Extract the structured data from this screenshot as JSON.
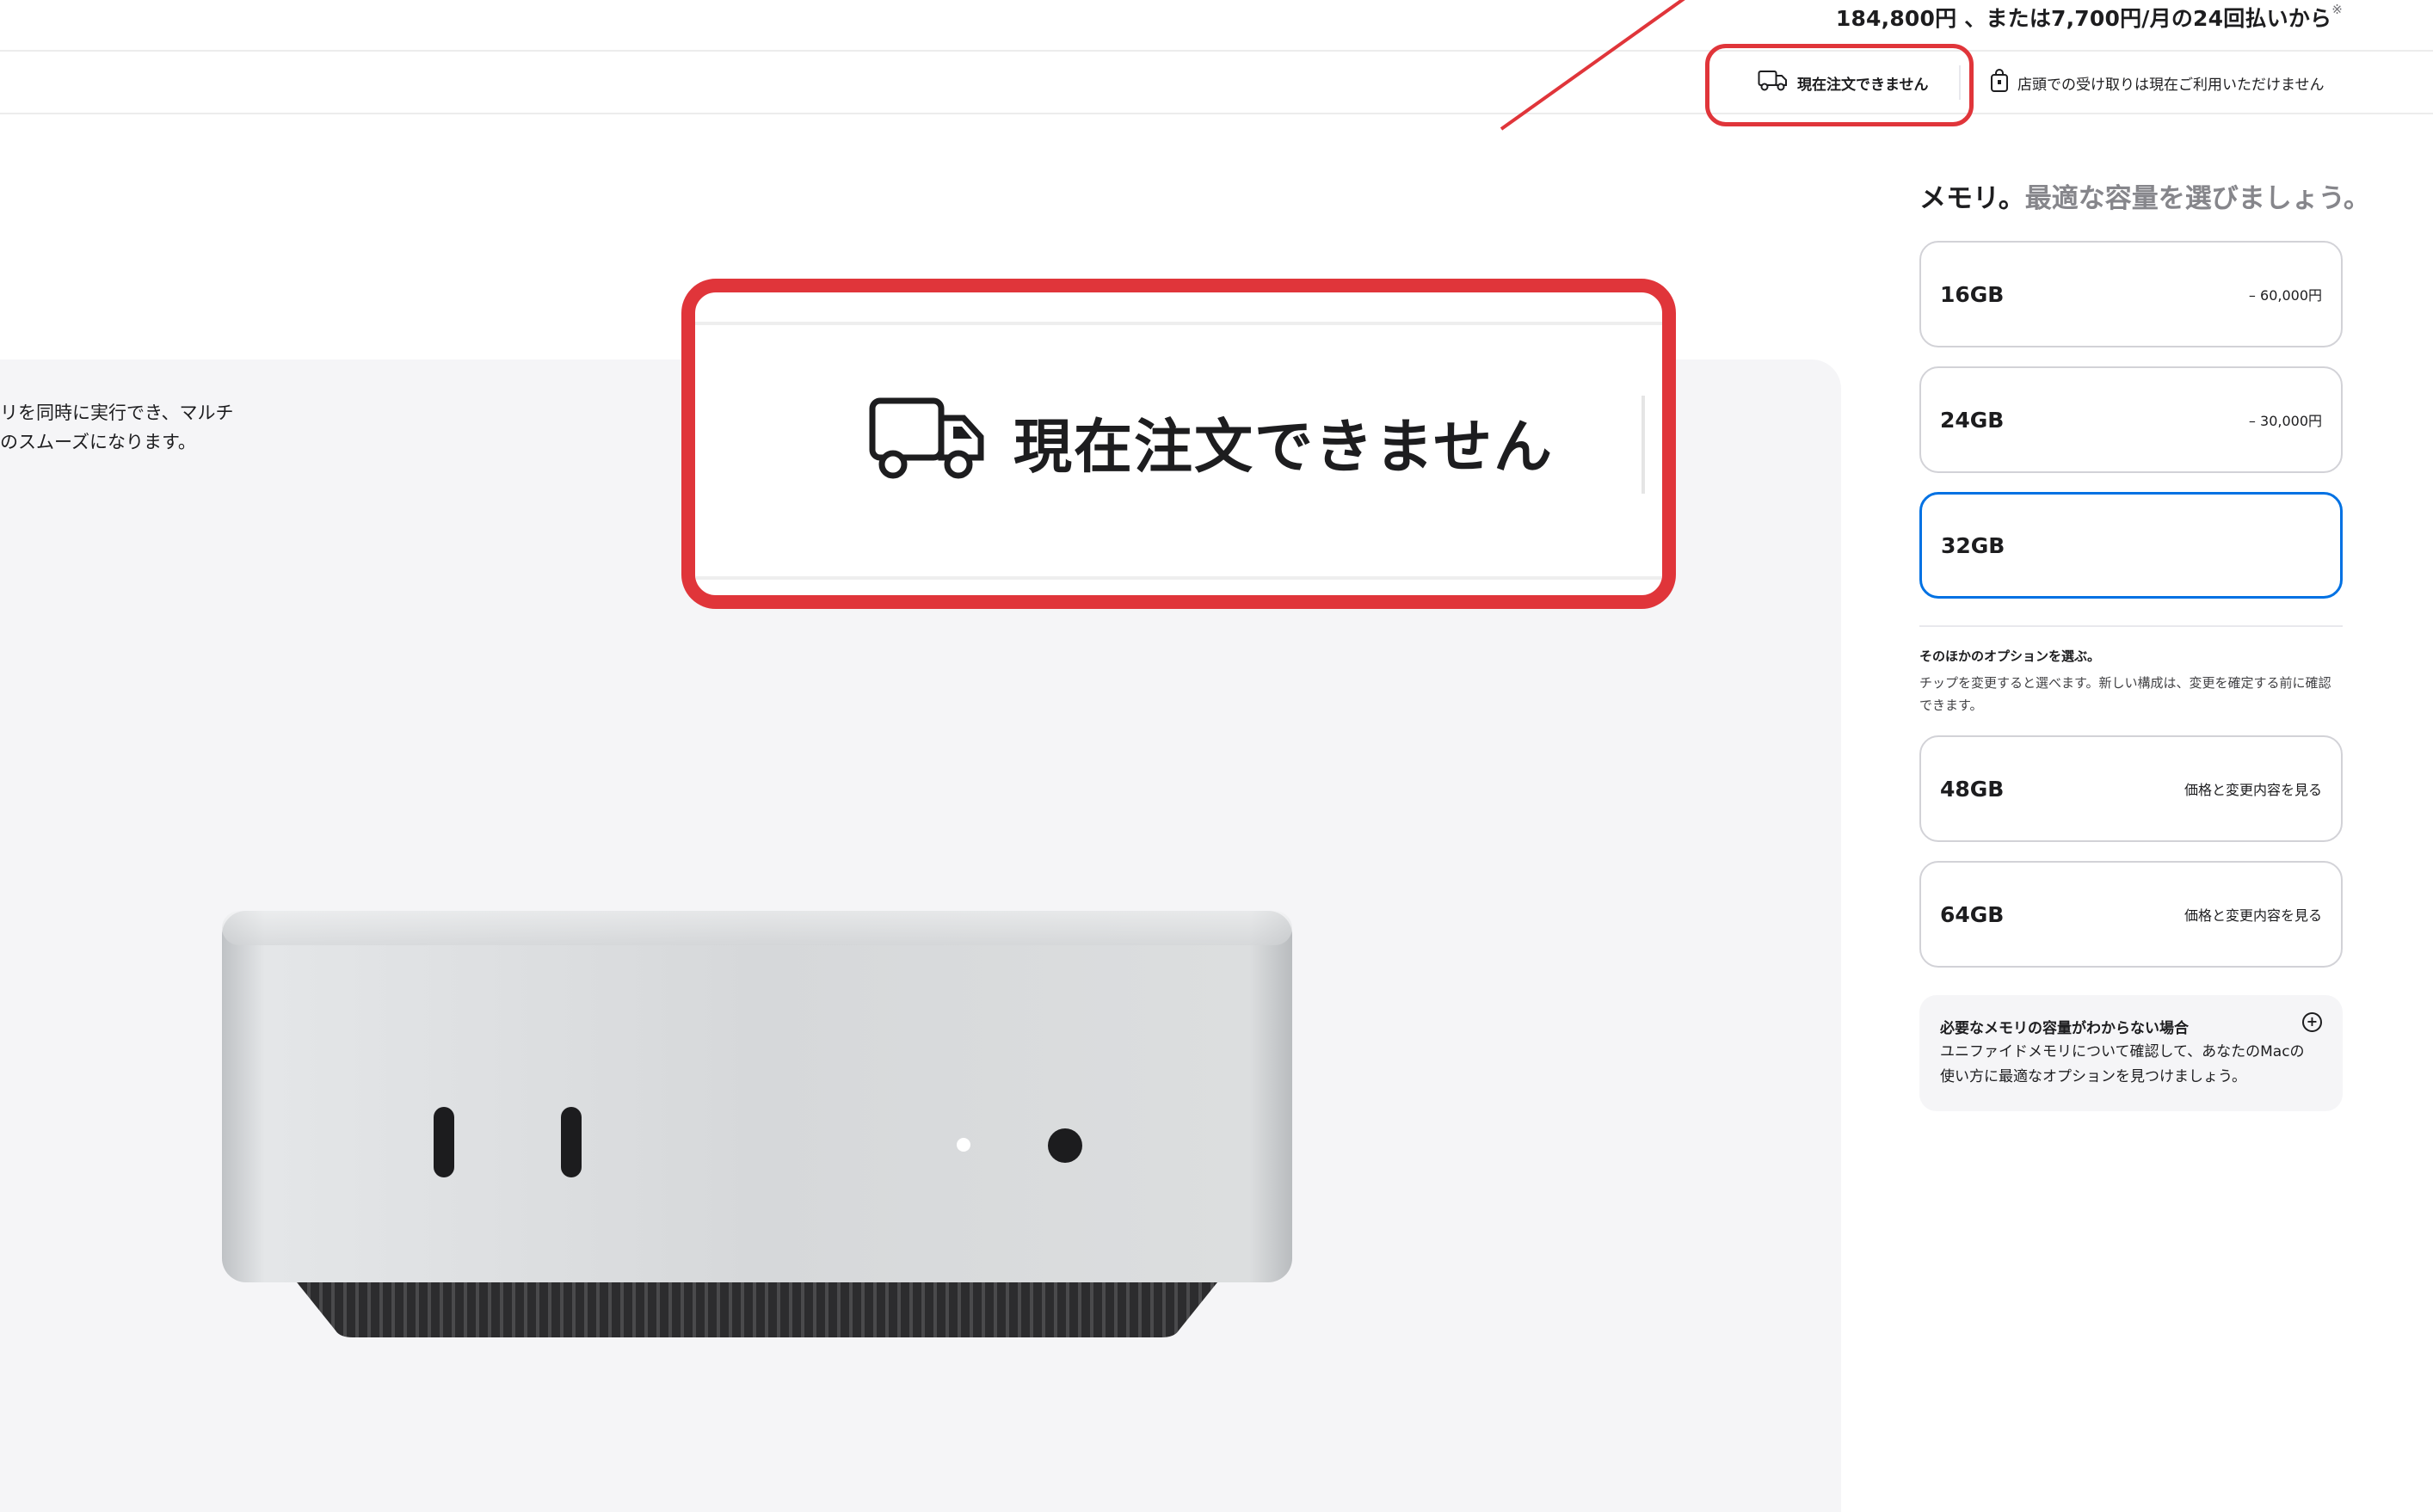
{
  "header": {
    "price_main": "184,800円 、または7,700円/月の24回払いから",
    "price_note": "※"
  },
  "availability": {
    "delivery": "現在注文できません",
    "pickup": "店頭での受け取りは現在ご利用いただけません"
  },
  "callout": {
    "zoom_text": "現在注文できません"
  },
  "gallery": {
    "text_line1": "リを同時に実行でき、マルチ",
    "text_line2": "のスムーズになります。"
  },
  "memory": {
    "title": "メモリ。",
    "subtitle": "最適な容量を選びましょう。",
    "options": [
      {
        "capacity": "16GB",
        "price": "– 60,000円",
        "selected": false
      },
      {
        "capacity": "24GB",
        "price": "– 30,000円",
        "selected": false
      },
      {
        "capacity": "32GB",
        "price": "",
        "selected": true
      }
    ],
    "other": {
      "title": "そのほかのオプションを選ぶ。",
      "desc": "チップを変更すると選べます。新しい構成は、変更を確定する前に確認できます。"
    },
    "extra_options": [
      {
        "capacity": "48GB",
        "action": "価格と変更内容を見る"
      },
      {
        "capacity": "64GB",
        "action": "価格と変更内容を見る"
      }
    ],
    "help": {
      "title": "必要なメモリの容量がわからない場合",
      "desc": "ユニファイドメモリについて確認して、あなたのMacの使い方に最適なオプションを見つけましょう。"
    }
  },
  "colors": {
    "accent_red": "#e0353a",
    "selected_blue": "#0071e3",
    "gallery_bg": "#f5f5f7"
  },
  "icons": [
    "truck-icon",
    "shopping-bag-icon",
    "plus-circle-icon"
  ]
}
